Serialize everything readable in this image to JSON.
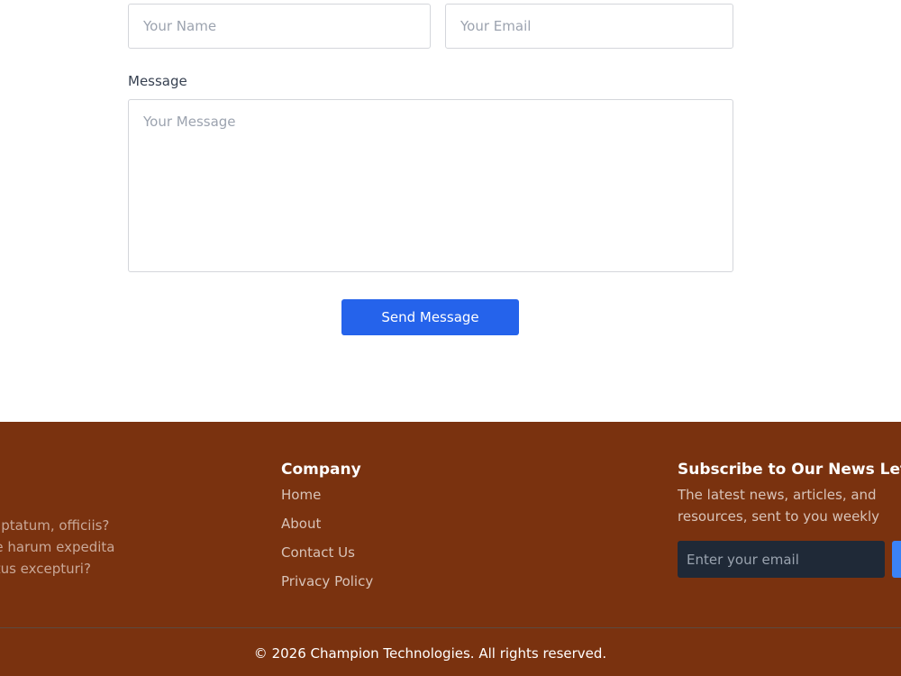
{
  "contact_form": {
    "name_placeholder": "Your Name",
    "email_placeholder": "Your Email",
    "message_label": "Message",
    "message_placeholder": "Your Message",
    "send_label": "Send Message",
    "send_color": "#2563eb"
  },
  "footer": {
    "background_color": "#7a320f",
    "about_text": "g elit. Voluptatum, officiis?\ntate eaque harum expedita\nlicabo, natus excepturi?",
    "company": {
      "heading": "Company",
      "links": [
        "Home",
        "About",
        "Contact Us",
        "Privacy Policy"
      ]
    },
    "newsletter": {
      "heading": "Subscribe to Our News Letter",
      "text": "The latest news, articles, and resources, sent to you weekly",
      "email_placeholder": "Enter your email"
    },
    "copyright": "© 2026 Champion Technologies. All rights reserved."
  }
}
